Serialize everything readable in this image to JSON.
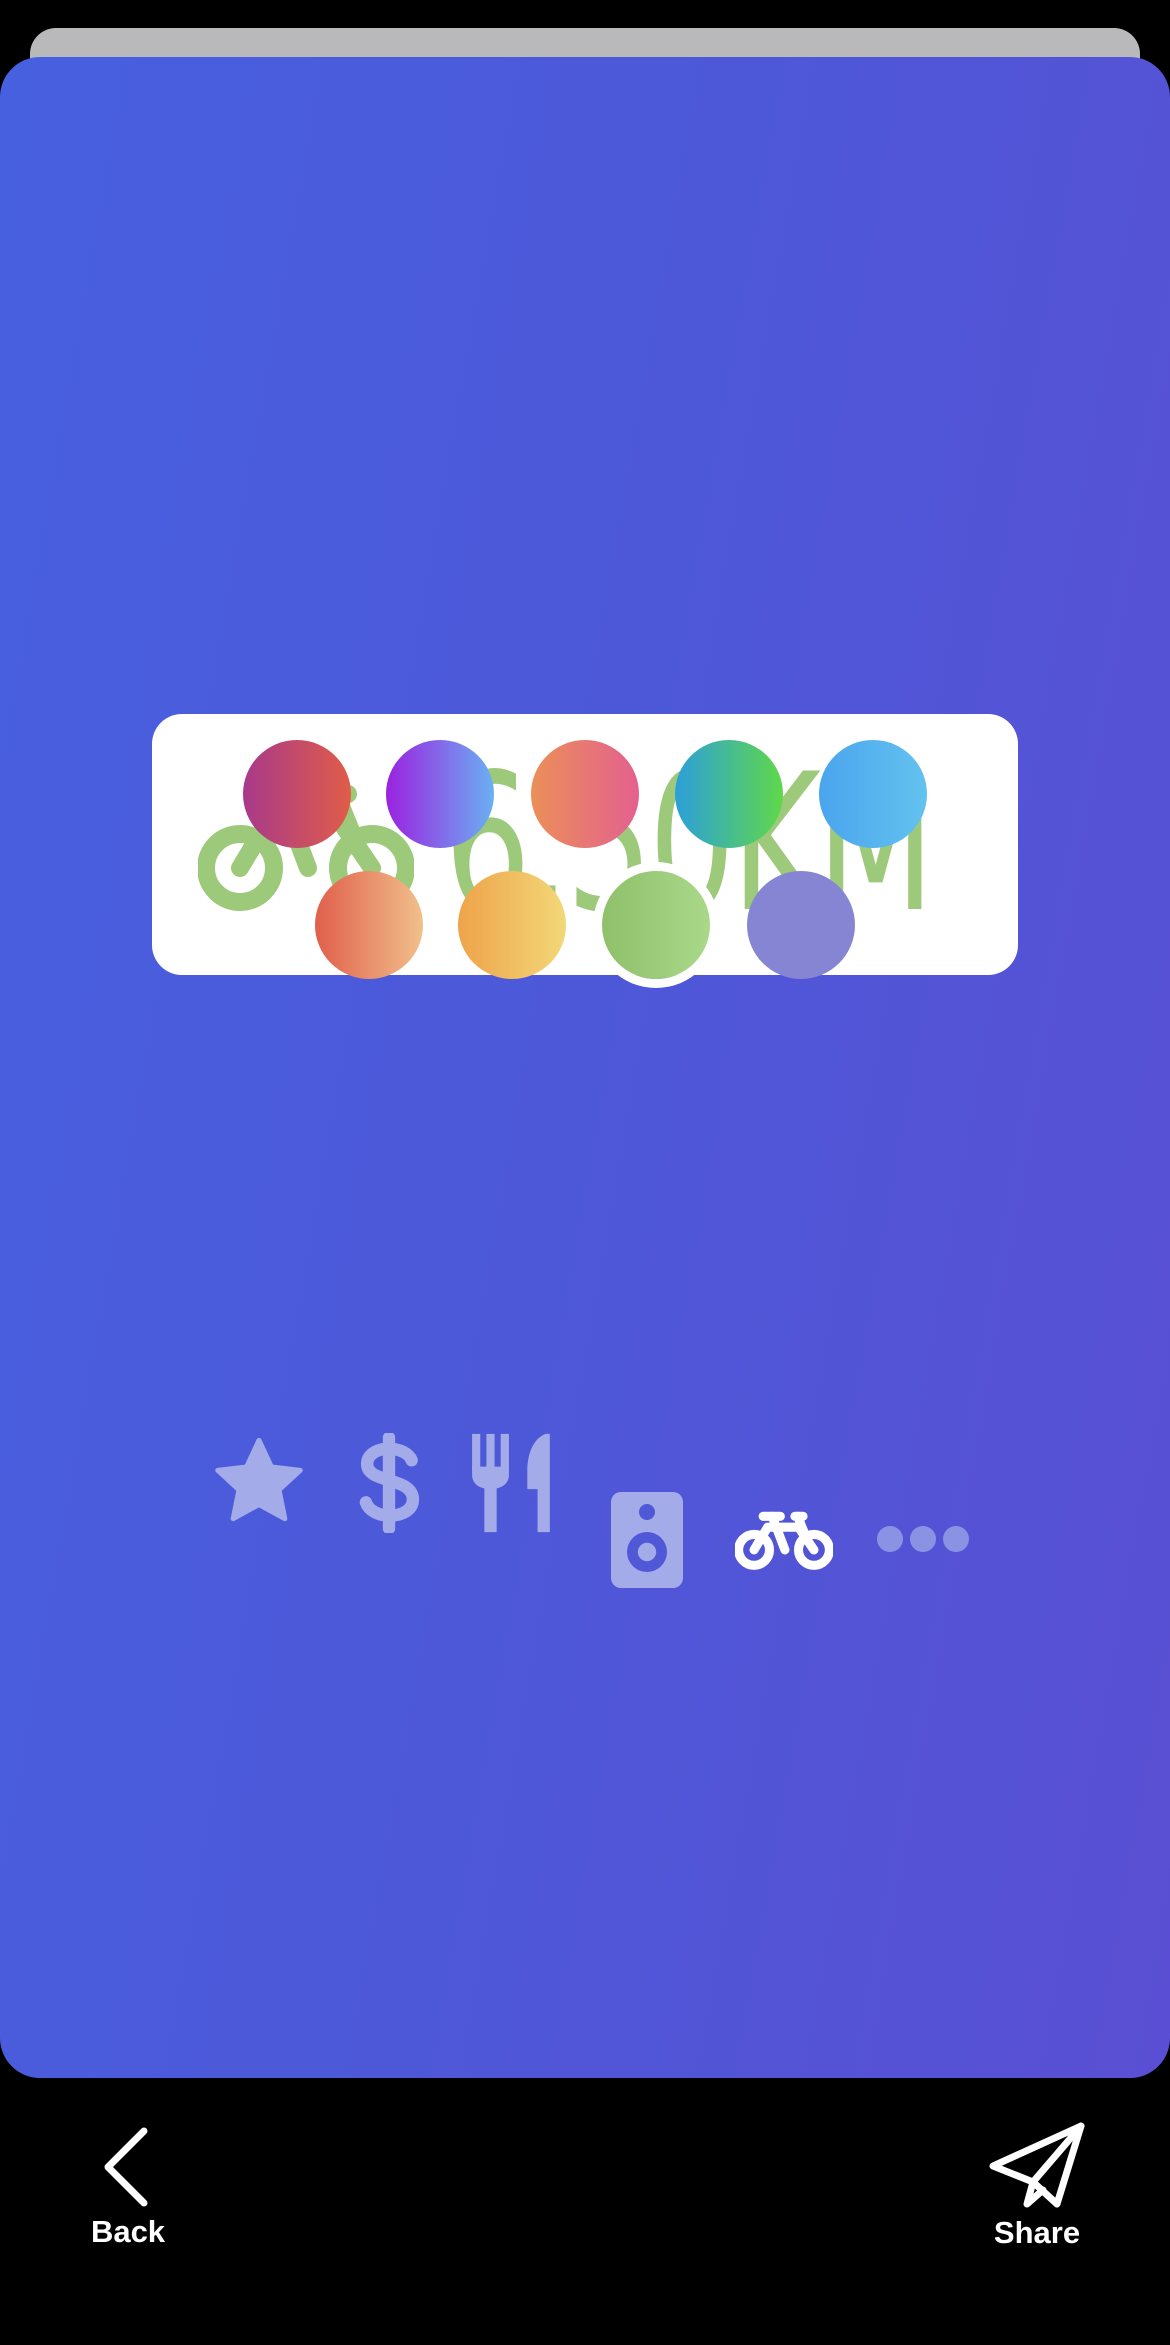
{
  "sticker": {
    "icon": "bicycle-icon",
    "distance_text": "6.50KM",
    "color": "#9dc97b"
  },
  "swatches": [
    {
      "name": "swatch-crimson",
      "from": "#a8398a",
      "to": "#e05d48",
      "selected": false
    },
    {
      "name": "swatch-purple-blue",
      "from": "#9b22e0",
      "to": "#6ab0f2",
      "selected": false
    },
    {
      "name": "swatch-orange-pink",
      "from": "#eb8f58",
      "to": "#e4608f",
      "selected": false
    },
    {
      "name": "swatch-teal-green",
      "from": "#2c9fd9",
      "to": "#60d84a",
      "selected": false
    },
    {
      "name": "swatch-sky-blue",
      "from": "#4aa5ee",
      "to": "#64c2ef",
      "selected": false
    },
    {
      "name": "swatch-coral-peach",
      "from": "#e05f4b",
      "to": "#f1c08b",
      "selected": false
    },
    {
      "name": "swatch-orange-yellow",
      "from": "#efa34a",
      "to": "#f2d878",
      "selected": false
    },
    {
      "name": "swatch-green",
      "from": "#8fc06a",
      "to": "#aad88a",
      "selected": true
    },
    {
      "name": "swatch-lavender",
      "from": "#8585d4",
      "to": "#8585d4",
      "selected": false
    }
  ],
  "tools": [
    {
      "name": "star-icon",
      "active": false
    },
    {
      "name": "dollar-icon",
      "active": false
    },
    {
      "name": "fork-knife-icon",
      "active": false
    },
    {
      "name": "speaker-icon",
      "active": false
    },
    {
      "name": "bicycle-icon",
      "active": true
    },
    {
      "name": "more-icon",
      "active": false
    }
  ],
  "bottom_bar": {
    "back_label": "Back",
    "back_icon": "chevron-left-icon",
    "share_label": "Share",
    "share_icon": "paper-plane-icon"
  }
}
